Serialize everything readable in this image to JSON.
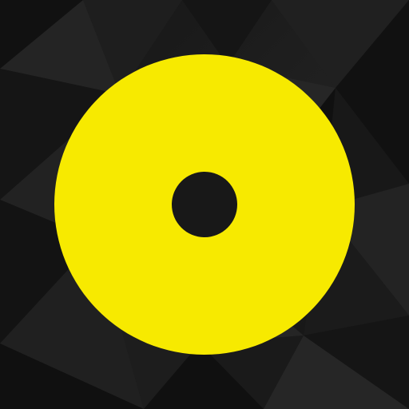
{
  "icon": {
    "name": "yellow-disc-icon"
  },
  "colors": {
    "background_base": "#171717",
    "background_dark": "#101010",
    "background_light": "#2a2a2a",
    "disc": "#f7ea00",
    "hole": "#181818"
  }
}
